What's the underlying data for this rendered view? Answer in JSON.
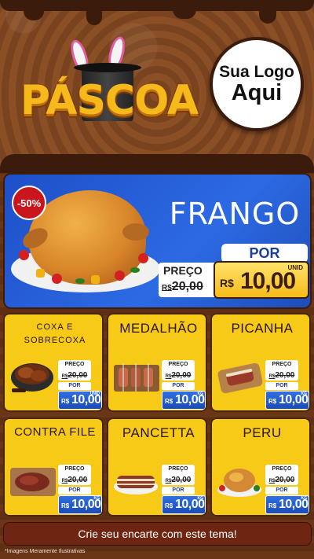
{
  "header": {
    "title": "PÁSCOA",
    "logo_line1": "Sua Logo",
    "logo_line2": "Aqui"
  },
  "hero": {
    "badge": "-50%",
    "name": "FRANGO",
    "por_label": "POR",
    "preco_label": "PREÇO",
    "old_currency": "R$",
    "old_price": "20,00",
    "unit": "UNID",
    "currency": "R$",
    "price": "10,00"
  },
  "cards": [
    {
      "title": "COXA E",
      "title2": "SOBRECOXA",
      "preco_label": "PREÇO",
      "old_currency": "R$",
      "old_price": "20,00",
      "por_label": "POR",
      "currency": "R$",
      "price": "10,00",
      "unit": "UNID"
    },
    {
      "title": "MEDALHÃO",
      "preco_label": "PREÇO",
      "old_currency": "R$",
      "old_price": "20,00",
      "por_label": "POR",
      "currency": "R$",
      "price": "10,00",
      "unit": "KG"
    },
    {
      "title": "PICANHA",
      "preco_label": "PREÇO",
      "old_currency": "R$",
      "old_price": "20,00",
      "por_label": "POR",
      "currency": "R$",
      "price": "10,00",
      "unit": "KG"
    },
    {
      "title": "CONTRA FILE",
      "preco_label": "PREÇO",
      "old_currency": "R$",
      "old_price": "20,00",
      "por_label": "POR",
      "currency": "R$",
      "price": "10,00",
      "unit": "KG"
    },
    {
      "title": "PANCETTA",
      "preco_label": "PREÇO",
      "old_currency": "R$",
      "old_price": "20,00",
      "por_label": "POR",
      "currency": "R$",
      "price": "10,00",
      "unit": "KG"
    },
    {
      "title": "PERU",
      "preco_label": "PREÇO",
      "old_currency": "R$",
      "old_price": "20,00",
      "por_label": "POR",
      "currency": "R$",
      "price": "10,00",
      "unit": "KG"
    }
  ],
  "footer": {
    "cta": "Crie seu encarte com este tema!",
    "note": "*Imagens Meramente Ilustrativas"
  },
  "colors": {
    "chocolate": "#5a2e16",
    "gold": "#f6b91c",
    "blue": "#2c6ae3",
    "card_yellow": "#f6ca17",
    "badge_red": "#c9151b"
  }
}
